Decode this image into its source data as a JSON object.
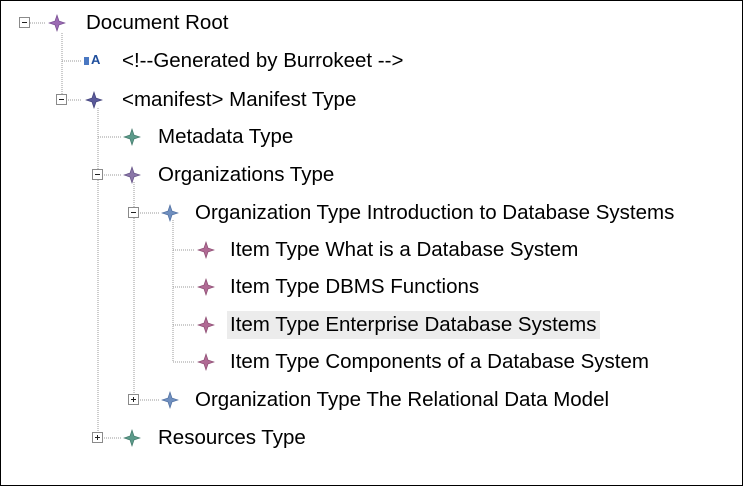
{
  "tree": {
    "nodes": [
      {
        "label": "Document Root",
        "icon": "purple-star-icon"
      },
      {
        "label": "<!--Generated by Burrokeet -->",
        "icon": "comment-text-icon"
      },
      {
        "label": "<manifest> Manifest Type",
        "icon": "navy-star-icon"
      },
      {
        "label": "Metadata Type",
        "icon": "green-star-icon"
      },
      {
        "label": "Organizations Type",
        "icon": "purple-star-icon"
      },
      {
        "label": "Organization Type Introduction to Database Systems",
        "icon": "blue-star-icon"
      },
      {
        "label": "Item Type What is a Database System",
        "icon": "pink-star-icon"
      },
      {
        "label": "Item Type DBMS Functions",
        "icon": "pink-star-icon"
      },
      {
        "label": "Item Type Enterprise Database Systems",
        "icon": "pink-star-icon",
        "selected": true
      },
      {
        "label": "Item Type Components of a Database System",
        "icon": "pink-star-icon"
      },
      {
        "label": "Organization Type The Relational Data Model",
        "icon": "blue-star-icon"
      },
      {
        "label": "Resources Type",
        "icon": "green-star-icon"
      }
    ]
  },
  "colors": {
    "purple_star": "#9b6bb3",
    "navy_star": "#5a5a9a",
    "green_star": "#5c9a8a",
    "blue_star": "#6f8fbf",
    "pink_star": "#b06a94",
    "selection": "#ececec"
  }
}
